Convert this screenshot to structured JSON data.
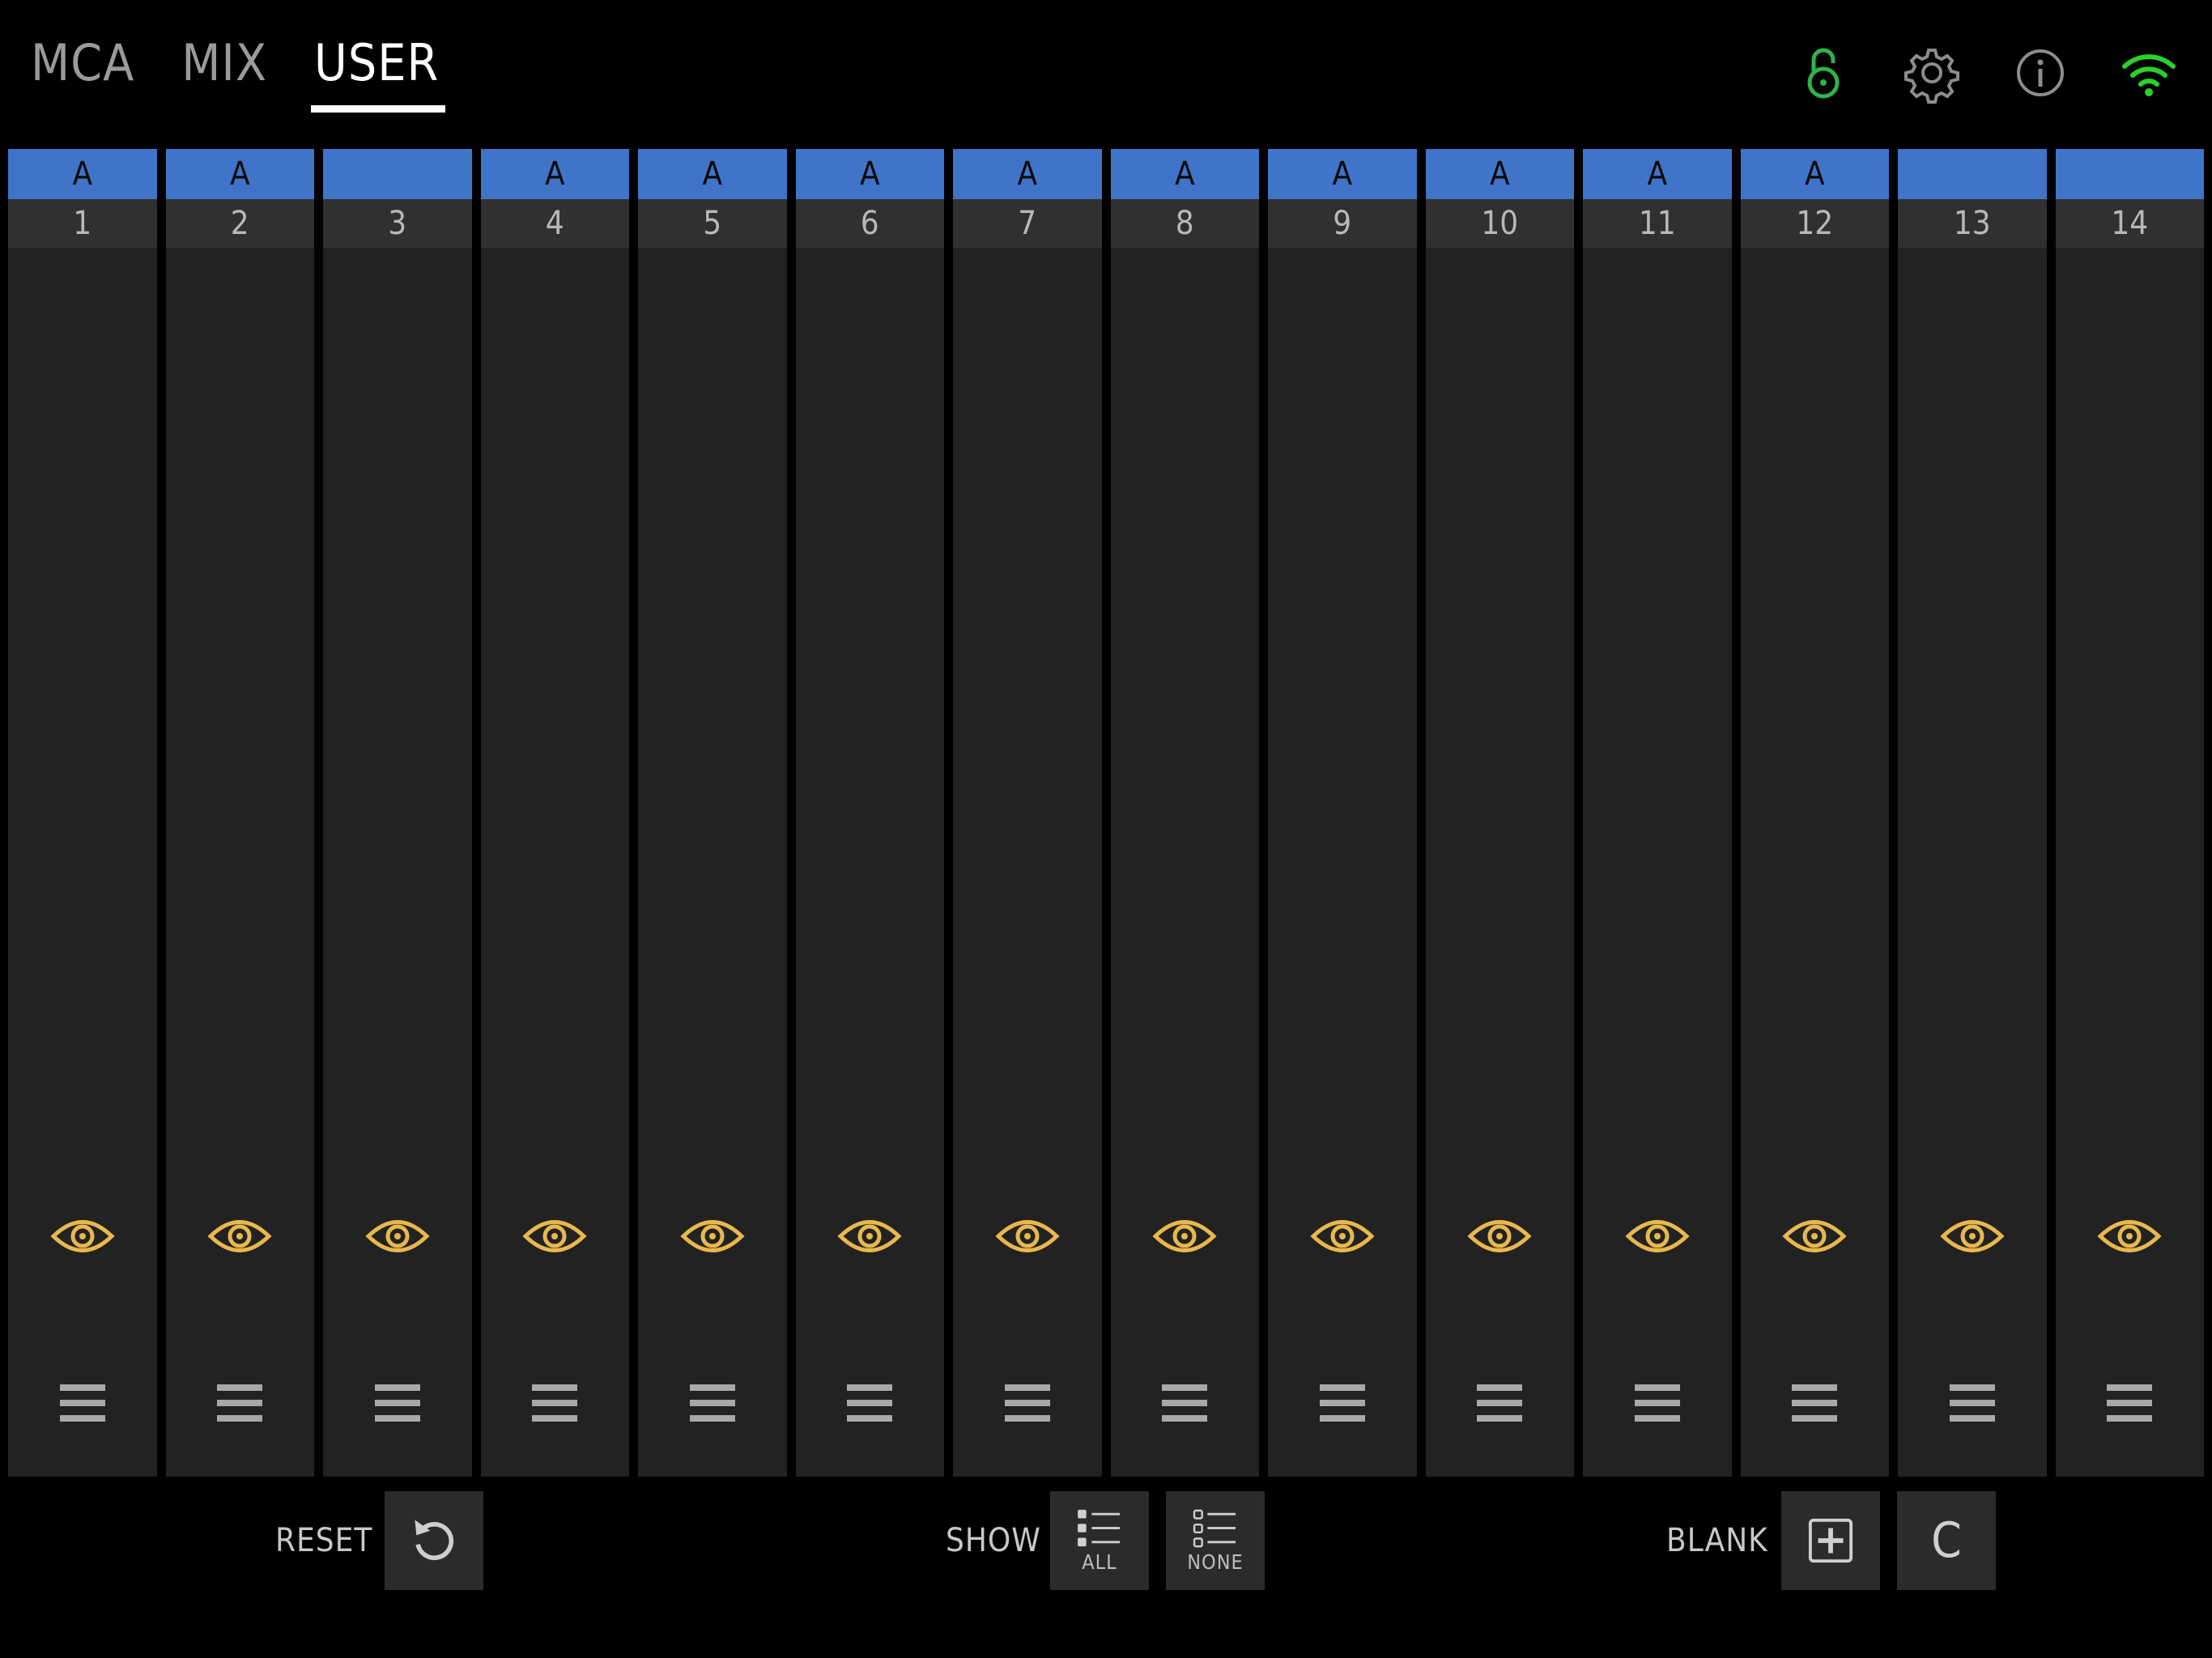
{
  "tabs": [
    {
      "label": "MCA",
      "active": false
    },
    {
      "label": "MIX",
      "active": false
    },
    {
      "label": "USER",
      "active": true
    }
  ],
  "status_icons": [
    "unlock-icon",
    "gear-icon",
    "info-icon",
    "wifi-icon"
  ],
  "colors": {
    "accent_blue": "#3f74c9",
    "eye_gold": "#e8b84e",
    "status_green": "#2fb34a",
    "wifi_green": "#2ad12a"
  },
  "strips": [
    {
      "tag": "A",
      "number": "1"
    },
    {
      "tag": "A",
      "number": "2"
    },
    {
      "tag": "",
      "number": "3"
    },
    {
      "tag": "A",
      "number": "4"
    },
    {
      "tag": "A",
      "number": "5"
    },
    {
      "tag": "A",
      "number": "6"
    },
    {
      "tag": "A",
      "number": "7"
    },
    {
      "tag": "A",
      "number": "8"
    },
    {
      "tag": "A",
      "number": "9"
    },
    {
      "tag": "A",
      "number": "10"
    },
    {
      "tag": "A",
      "number": "11"
    },
    {
      "tag": "A",
      "number": "12"
    },
    {
      "tag": "",
      "number": "13"
    },
    {
      "tag": "",
      "number": "14"
    }
  ],
  "bottom": {
    "reset_label": "RESET",
    "show_label": "SHOW",
    "show_all_label": "ALL",
    "show_none_label": "NONE",
    "blank_label": "BLANK",
    "clear_label": "C"
  }
}
